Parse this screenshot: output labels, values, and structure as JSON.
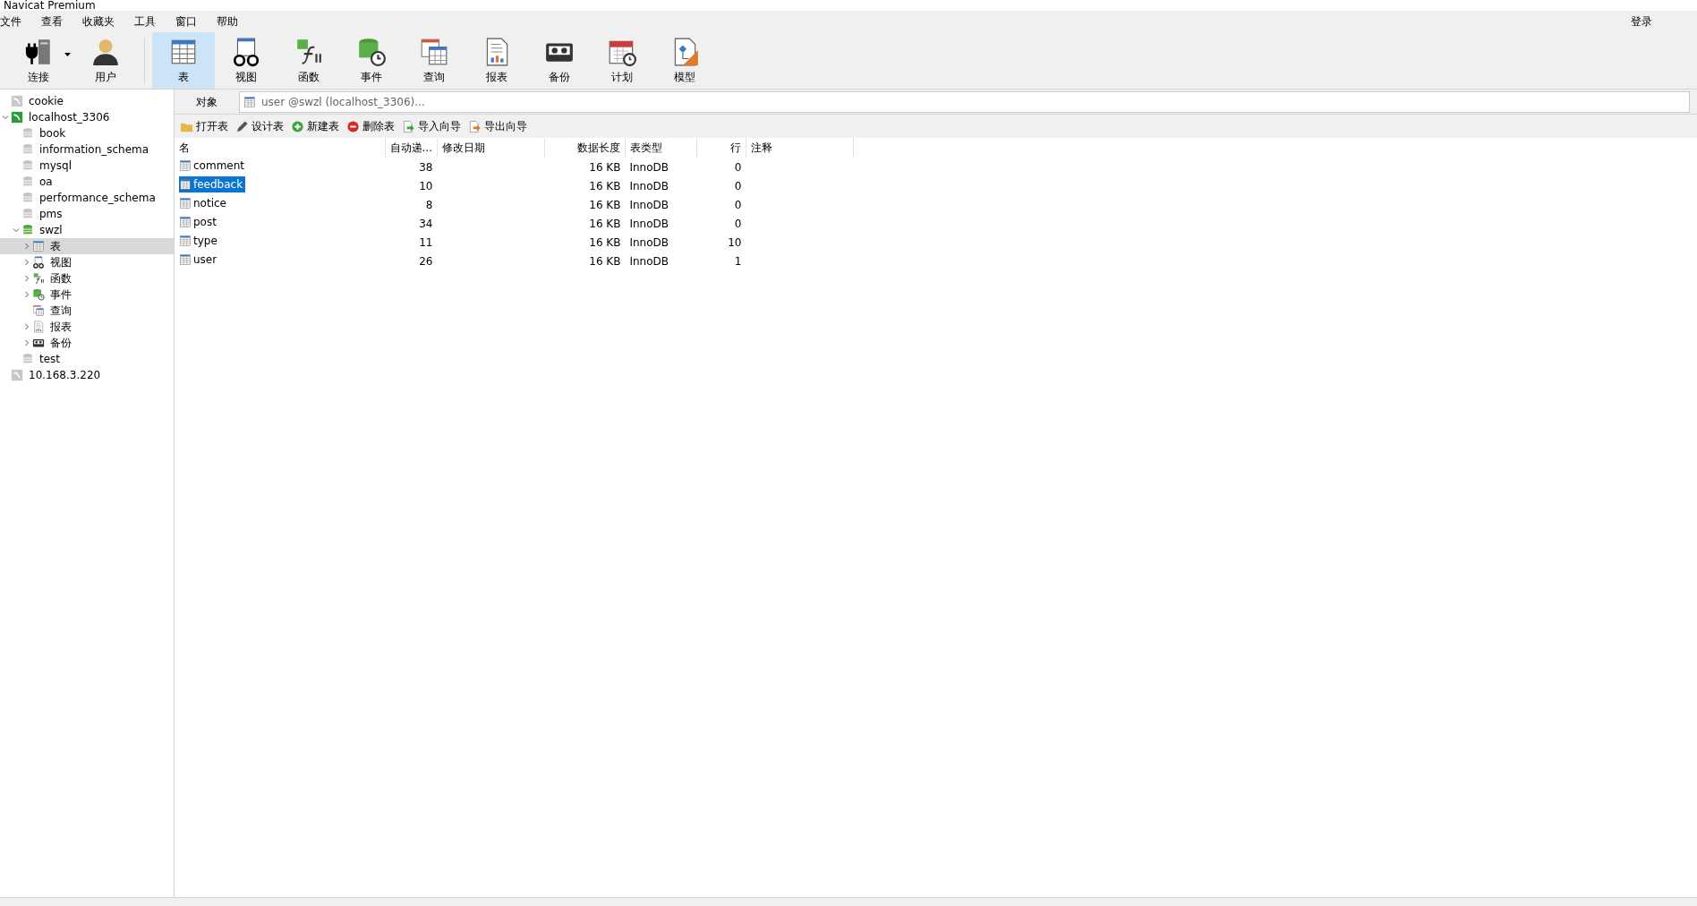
{
  "window": {
    "title": "Navicat Premium"
  },
  "menu": [
    "文件",
    "查看",
    "收藏夹",
    "工具",
    "窗口",
    "帮助"
  ],
  "login": "登录",
  "toolbar": [
    {
      "label": "连接",
      "kind": "connect",
      "selected": false,
      "dropdown": true
    },
    {
      "label": "用户",
      "kind": "user",
      "selected": false,
      "dropdown": false
    },
    {
      "label": "表",
      "kind": "table",
      "selected": true,
      "dropdown": false
    },
    {
      "label": "视图",
      "kind": "view",
      "selected": false,
      "dropdown": false
    },
    {
      "label": "函数",
      "kind": "function",
      "selected": false,
      "dropdown": false
    },
    {
      "label": "事件",
      "kind": "event",
      "selected": false,
      "dropdown": false
    },
    {
      "label": "查询",
      "kind": "query",
      "selected": false,
      "dropdown": false
    },
    {
      "label": "报表",
      "kind": "report",
      "selected": false,
      "dropdown": false
    },
    {
      "label": "备份",
      "kind": "backup",
      "selected": false,
      "dropdown": false
    },
    {
      "label": "计划",
      "kind": "schedule",
      "selected": false,
      "dropdown": false
    },
    {
      "label": "模型",
      "kind": "model",
      "selected": false,
      "dropdown": false
    }
  ],
  "sidebar": {
    "tree": [
      {
        "label": "cookie",
        "kind": "connection",
        "active": false,
        "expandable": false,
        "selected": false
      },
      {
        "label": "localhost_3306",
        "kind": "connection",
        "active": true,
        "expanded": true,
        "expandable": true,
        "selected": false,
        "children": [
          {
            "label": "book",
            "kind": "database",
            "active": false,
            "expandable": false,
            "selected": false
          },
          {
            "label": "information_schema",
            "kind": "database",
            "active": false,
            "expandable": false,
            "selected": false
          },
          {
            "label": "mysql",
            "kind": "database",
            "active": false,
            "expandable": false,
            "selected": false
          },
          {
            "label": "oa",
            "kind": "database",
            "active": false,
            "expandable": false,
            "selected": false
          },
          {
            "label": "performance_schema",
            "kind": "database",
            "active": false,
            "expandable": false,
            "selected": false
          },
          {
            "label": "pms",
            "kind": "database",
            "active": false,
            "expandable": false,
            "selected": false
          },
          {
            "label": "swzl",
            "kind": "database",
            "active": true,
            "expanded": true,
            "expandable": true,
            "selected": false,
            "children": [
              {
                "label": "表",
                "kind": "table",
                "expanded": false,
                "expandable": true,
                "selected": true
              },
              {
                "label": "视图",
                "kind": "view",
                "expanded": false,
                "expandable": true,
                "selected": false
              },
              {
                "label": "函数",
                "kind": "function",
                "expanded": false,
                "expandable": true,
                "selected": false
              },
              {
                "label": "事件",
                "kind": "event",
                "expanded": false,
                "expandable": true,
                "selected": false
              },
              {
                "label": "查询",
                "kind": "query",
                "expandable": false,
                "selected": false
              },
              {
                "label": "报表",
                "kind": "report",
                "expanded": false,
                "expandable": true,
                "selected": false
              },
              {
                "label": "备份",
                "kind": "backup",
                "expanded": false,
                "expandable": true,
                "selected": false
              }
            ]
          },
          {
            "label": "test",
            "kind": "database",
            "active": false,
            "expandable": false,
            "selected": false
          }
        ]
      },
      {
        "label": "10.168.3.220",
        "kind": "connection",
        "active": false,
        "expandable": false,
        "selected": false
      }
    ]
  },
  "object_tab": {
    "label": "对象",
    "address": "user @swzl (localhost_3306)..."
  },
  "actions": [
    {
      "label": "打开表",
      "kind": "open"
    },
    {
      "label": "设计表",
      "kind": "design"
    },
    {
      "label": "新建表",
      "kind": "new"
    },
    {
      "label": "删除表",
      "kind": "delete"
    },
    {
      "label": "导入向导",
      "kind": "import"
    },
    {
      "label": "导出向导",
      "kind": "export"
    }
  ],
  "table": {
    "columns": [
      {
        "label": "名"
      },
      {
        "label": "自动递..."
      },
      {
        "label": "修改日期"
      },
      {
        "label": "数据长度"
      },
      {
        "label": "表类型"
      },
      {
        "label": "行"
      },
      {
        "label": "注释"
      }
    ],
    "rows": [
      {
        "selected": false,
        "cells": [
          "comment",
          "38",
          "",
          "16 KB",
          "InnoDB",
          "0",
          ""
        ]
      },
      {
        "selected": true,
        "cells": [
          "feedback",
          "10",
          "",
          "16 KB",
          "InnoDB",
          "0",
          ""
        ]
      },
      {
        "selected": false,
        "cells": [
          "notice",
          "8",
          "",
          "16 KB",
          "InnoDB",
          "0",
          ""
        ]
      },
      {
        "selected": false,
        "cells": [
          "post",
          "34",
          "",
          "16 KB",
          "InnoDB",
          "0",
          ""
        ]
      },
      {
        "selected": false,
        "cells": [
          "type",
          "11",
          "",
          "16 KB",
          "InnoDB",
          "10",
          ""
        ]
      },
      {
        "selected": false,
        "cells": [
          "user",
          "26",
          "",
          "16 KB",
          "InnoDB",
          "1",
          ""
        ]
      }
    ]
  }
}
